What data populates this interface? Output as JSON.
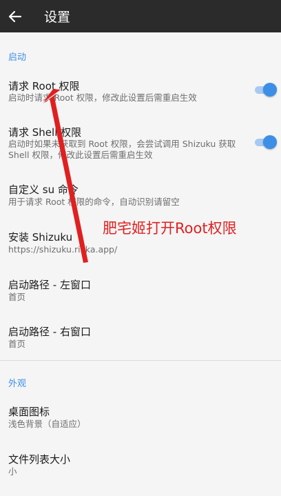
{
  "header": {
    "title": "设置",
    "back_icon": "arrow-left-icon"
  },
  "sections": [
    {
      "header": "启动",
      "items": [
        {
          "title": "请求 Root 权限",
          "subtitle": "启动时请求 Root 权限，修改此设置后需重启生效",
          "toggle": true
        },
        {
          "title": "请求 Shell 权限",
          "subtitle": "启动时如果未获取到 Root 权限，会尝试调用 Shizuku 获取 Shell 权限，修改此设置后需重启生效",
          "toggle": true
        },
        {
          "title": "自定义 su 命令",
          "subtitle": "用于请求 Root 权限的命令，自动识别请留空"
        },
        {
          "title": "安装 Shizuku",
          "subtitle": "https://shizuku.rikka.app/"
        },
        {
          "title": "启动路径 - 左窗口",
          "subtitle": "首页"
        },
        {
          "title": "启动路径 - 右窗口",
          "subtitle": "首页"
        }
      ]
    },
    {
      "header": "外观",
      "items": [
        {
          "title": "桌面图标",
          "subtitle": "浅色背景（自适应）"
        },
        {
          "title": "文件列表大小",
          "subtitle": "小"
        }
      ]
    }
  ],
  "annotation": {
    "text": "肥宅姬打开Root权限",
    "color": "#e02020"
  },
  "colors": {
    "accent": "#3d8ee6",
    "appbar": "#2b2b2b",
    "background": "#f5f5f5"
  }
}
